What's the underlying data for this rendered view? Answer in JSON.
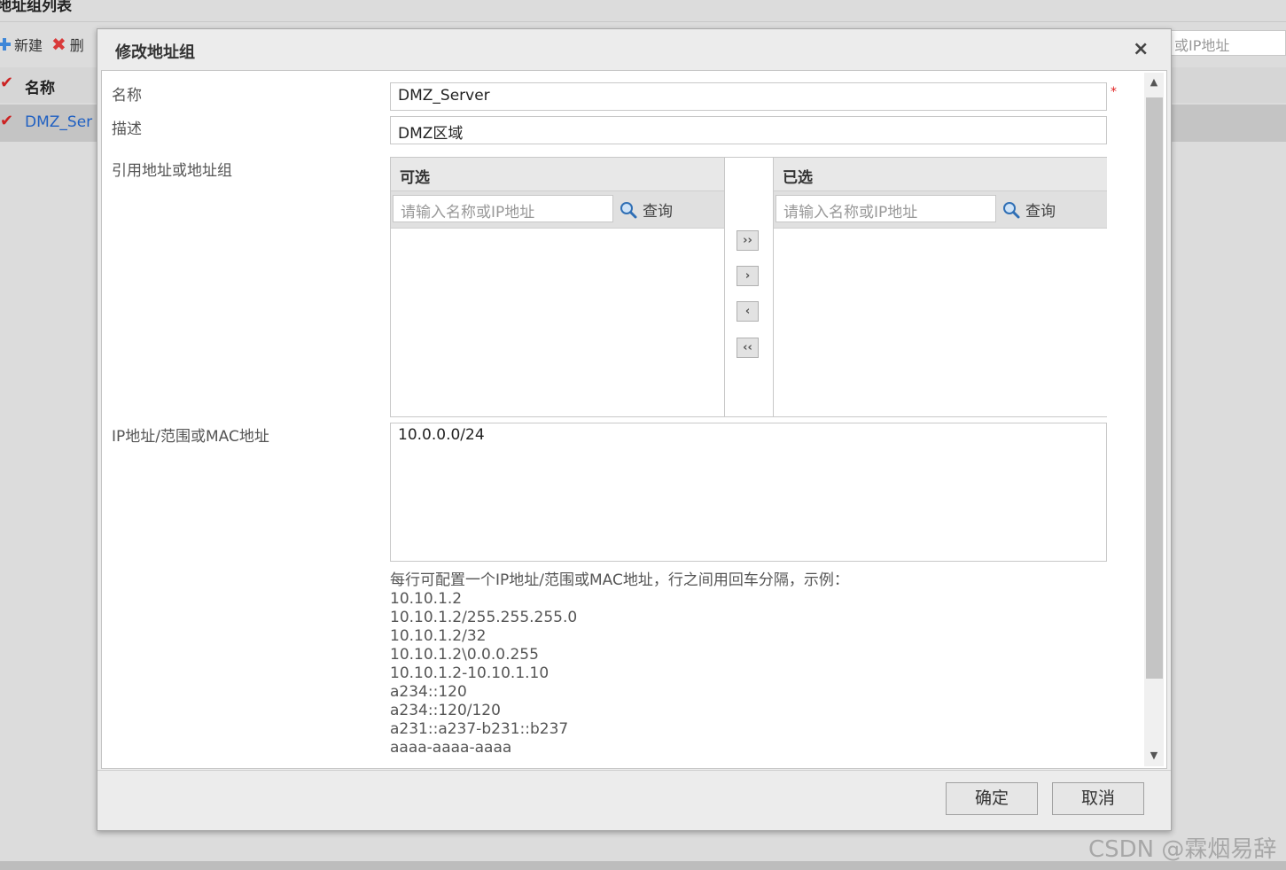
{
  "background": {
    "page_title": "地址组列表",
    "toolbar": {
      "new_label": "新建",
      "delete_label": "删"
    },
    "search_placeholder": "或IP地址",
    "table": {
      "column_name": "名称",
      "row_name": "DMZ_Ser"
    }
  },
  "watermark": "CSDN @霖烟易辞",
  "dialog": {
    "title": "修改地址组",
    "close_symbol": "×",
    "form": {
      "name_label": "名称",
      "name_value": "DMZ_Server",
      "required_mark": "*",
      "desc_label": "描述",
      "desc_value": "DMZ区域",
      "ref_label": "引用地址或地址组",
      "ip_label": "IP地址/范围或MAC地址",
      "ip_value": "10.0.0.0/24"
    },
    "picker": {
      "available_title": "可选",
      "selected_title": "已选",
      "search_placeholder": "请输入名称或IP地址",
      "search_button": "查询",
      "move_all_right": "››",
      "move_right": "›",
      "move_left": "‹",
      "move_all_left": "‹‹"
    },
    "hint": {
      "intro": "每行可配置一个IP地址/范围或MAC地址，行之间用回车分隔，示例：",
      "examples": [
        "10.10.1.2",
        "10.10.1.2/255.255.255.0",
        "10.10.1.2/32",
        "10.10.1.2\\0.0.0.255",
        "10.10.1.2-10.10.1.10",
        "a234::120",
        "a234::120/120",
        "a231::a237-b231::b237",
        "aaaa-aaaa-aaaa"
      ]
    },
    "buttons": {
      "ok": "确定",
      "cancel": "取消"
    },
    "scrollbar": {
      "up": "▲",
      "down": "▼"
    }
  }
}
